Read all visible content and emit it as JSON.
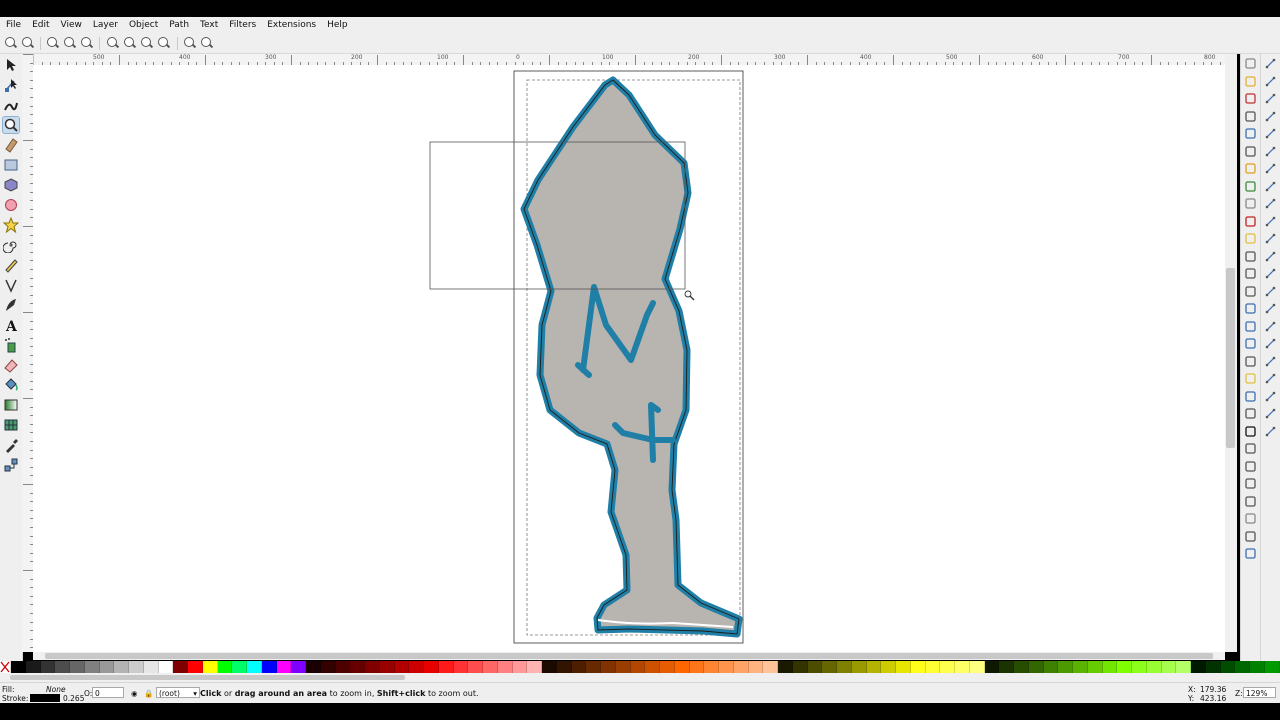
{
  "menu": [
    "File",
    "Edit",
    "View",
    "Layer",
    "Object",
    "Path",
    "Text",
    "Filters",
    "Extensions",
    "Help"
  ],
  "ruler": {
    "labels": [
      "500",
      "400",
      "300",
      "200",
      "100",
      "0",
      "100",
      "200",
      "300",
      "400",
      "500",
      "600",
      "700",
      "800"
    ]
  },
  "icons": {
    "zoom_toolbar": [
      "zoom-in-icon",
      "zoom-out-icon",
      "zoom-1-1-icon",
      "zoom-1-2-icon",
      "zoom-2-1-icon",
      "zoom-selection-icon",
      "zoom-drawing-icon",
      "zoom-page-icon",
      "zoom-page-width-icon",
      "zoom-prev-icon",
      "zoom-next-icon"
    ],
    "tools": [
      "selector-tool-icon",
      "node-tool-icon",
      "tweak-tool-icon",
      "zoom-tool-icon",
      "measure-tool-icon",
      "rectangle-tool-icon",
      "3d-box-tool-icon",
      "ellipse-tool-icon",
      "star-tool-icon",
      "spiral-tool-icon",
      "pencil-tool-icon",
      "pen-tool-icon",
      "calligraphy-tool-icon",
      "text-tool-icon",
      "spray-tool-icon",
      "eraser-tool-icon",
      "bucket-tool-icon",
      "gradient-tool-icon",
      "mesh-tool-icon",
      "dropper-tool-icon",
      "connector-tool-icon"
    ]
  },
  "active_tool": "zoom-tool-icon",
  "colors": {
    "drawing_fill": "#b8b4b0",
    "drawing_stroke": "#1f7fa6",
    "selection_box": "#555555"
  },
  "palette": [
    "#000000",
    "#1a1a1a",
    "#333333",
    "#4d4d4d",
    "#666666",
    "#808080",
    "#999999",
    "#b3b3b3",
    "#cccccc",
    "#e6e6e6",
    "#ffffff",
    "#800000",
    "#ff0000",
    "#ffff00",
    "#00ff00",
    "#00ff66",
    "#00ffff",
    "#0000ff",
    "#ff00ff",
    "#8000ff",
    "#1a0000",
    "#330000",
    "#4d0000",
    "#660000",
    "#800000",
    "#990000",
    "#b30000",
    "#cc0000",
    "#e60000",
    "#ff1a1a",
    "#ff3333",
    "#ff4d4d",
    "#ff6666",
    "#ff8080",
    "#ff9999",
    "#ffb3b3",
    "#1a0a00",
    "#331400",
    "#4d1f00",
    "#662900",
    "#803300",
    "#993d00",
    "#b34700",
    "#cc5200",
    "#e65c00",
    "#ff6600",
    "#ff751a",
    "#ff8533",
    "#ff944d",
    "#ffa366",
    "#ffb380",
    "#ffc299",
    "#1a1a00",
    "#333300",
    "#4d4d00",
    "#666600",
    "#808000",
    "#999900",
    "#b3b300",
    "#cccc00",
    "#e6e600",
    "#ffff1a",
    "#ffff33",
    "#ffff4d",
    "#ffff66",
    "#ffff80",
    "#0d1a00",
    "#1a3300",
    "#264d00",
    "#336600",
    "#408000",
    "#4d9900",
    "#59b300",
    "#66cc00",
    "#73e600",
    "#80ff00",
    "#8cff1a",
    "#99ff33",
    "#a6ff4d",
    "#b3ff66",
    "#001a00",
    "#003300",
    "#004d00",
    "#006600",
    "#008000",
    "#009900"
  ],
  "status": {
    "fill_label": "Fill:",
    "fill_value": "None",
    "stroke_label": "Stroke:",
    "stroke_width": "0.265",
    "opacity_label": "O:",
    "opacity_value": "0",
    "layer": "(root)",
    "msg_click": "Click",
    "msg_or": " or ",
    "msg_drag": "drag around an area",
    "msg_mid": " to zoom in, ",
    "msg_shift": "Shift+click",
    "msg_end": " to zoom out.",
    "x_label": "X:",
    "x_value": "179.36",
    "y_label": "Y:",
    "y_value": "423.16",
    "z_label": "Z:",
    "zoom_value": "129%"
  }
}
